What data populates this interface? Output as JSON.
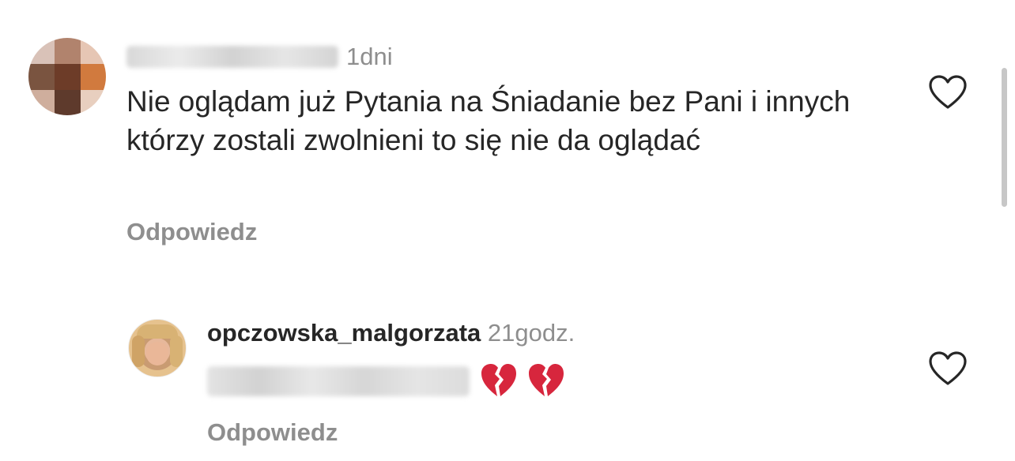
{
  "comments": [
    {
      "time": "1dni",
      "text": "Nie oglądam już Pytania na Śniadanie bez Pani i innych którzy zostali zwolnieni to się nie da oglądać",
      "reply_label": "Odpowiedz",
      "like_icon": "heart-outline-icon"
    },
    {
      "username": "opczowska_malgorzata",
      "time": "21godz.",
      "emojis": [
        "broken-heart-emoji",
        "broken-heart-emoji"
      ],
      "reply_label": "Odpowiedz",
      "like_icon": "heart-outline-icon"
    }
  ],
  "colors": {
    "text": "#262626",
    "muted": "#8e8e8e",
    "emoji_red": "#d7263d"
  }
}
